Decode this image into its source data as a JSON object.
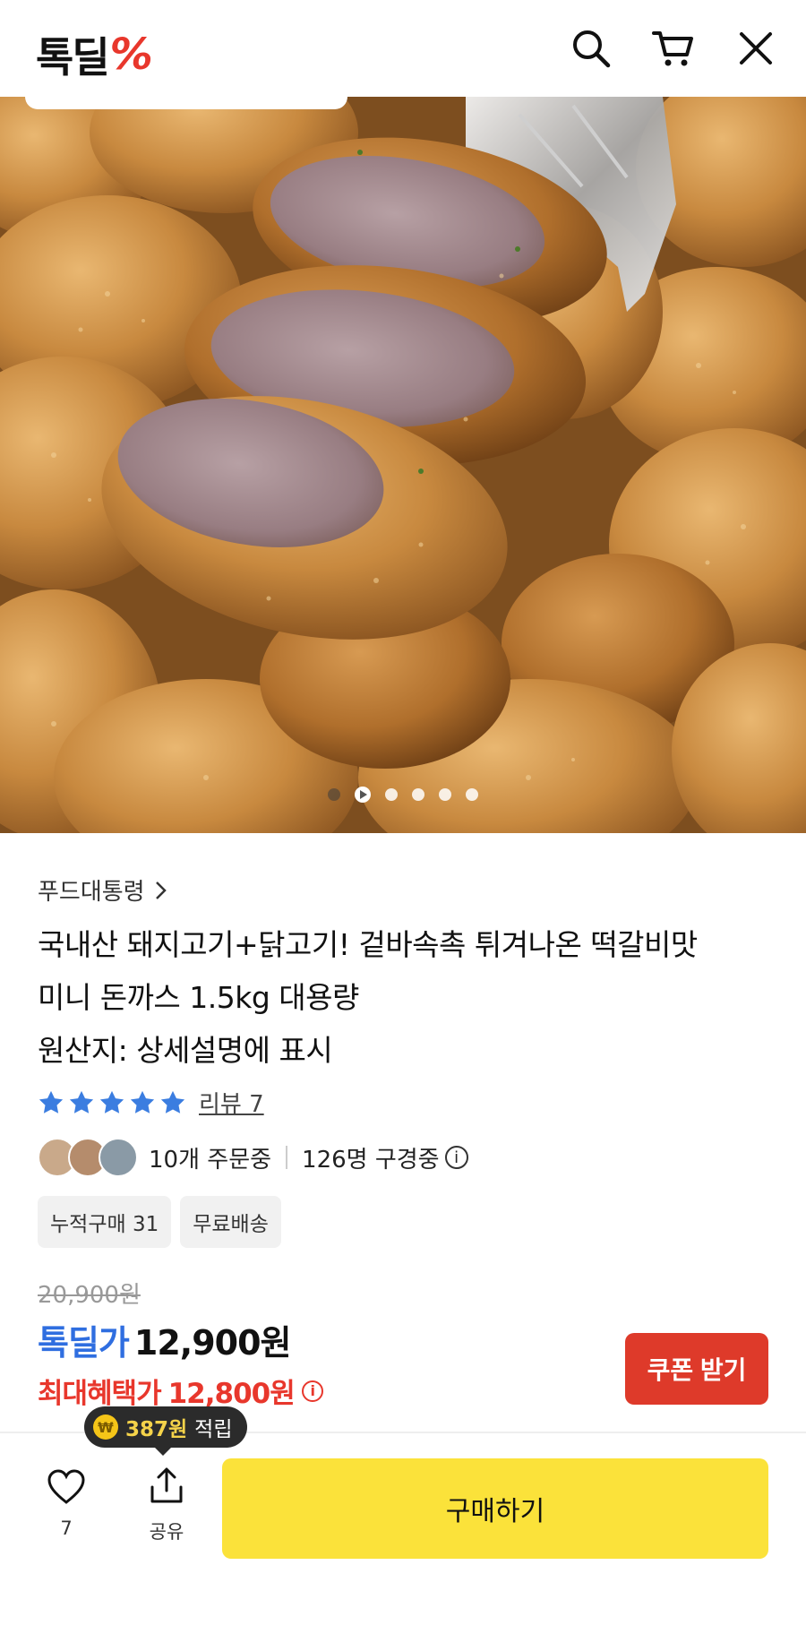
{
  "header": {
    "logo_text": "톡딜",
    "logo_mark": "%",
    "icons": [
      "search-icon",
      "cart-icon",
      "close-icon"
    ]
  },
  "gallery": {
    "slide_count": 6,
    "active_index": 0
  },
  "product": {
    "seller": "푸드대통령",
    "title_line1": "국내산 돼지고기+닭고기! 겉바속촉 튀겨나온 떡갈비맛",
    "title_line2": "미니 돈까스 1.5kg 대용량",
    "title_line3": "원산지: 상세설명에 표시",
    "rating_stars": 5,
    "review_link": "리뷰 7",
    "ordering": "10개 주문중",
    "watching": "126명 구경중",
    "tags": [
      "누적구매 31",
      "무료배송"
    ]
  },
  "price": {
    "original": "20,900원",
    "deal_label": "톡딜가",
    "deal_price": "12,900원",
    "max_benefit_label": "최대혜택가",
    "max_benefit_price": "12,800원",
    "coupon_button": "쿠폰 받기"
  },
  "points": {
    "amount": "387원",
    "suffix": "적립"
  },
  "bottom_bar": {
    "like_count": "7",
    "share_label": "공유",
    "buy_button": "구매하기"
  },
  "colors": {
    "brand_red": "#e8372c",
    "deal_blue": "#2f6ee0",
    "buy_yellow": "#fbe23a",
    "coupon_red": "#de3a2a",
    "star_blue": "#3b7de0"
  }
}
